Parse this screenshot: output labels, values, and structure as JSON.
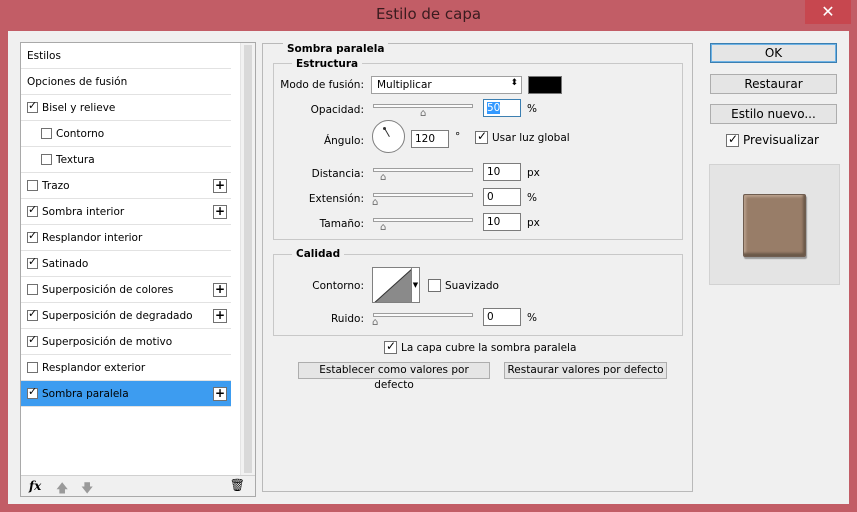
{
  "window": {
    "title": "Estilo de capa",
    "close_icon": "✕"
  },
  "styles_list": {
    "items": [
      {
        "label": "Estilos",
        "checkbox": false,
        "checked": false,
        "plus": false,
        "sub": false,
        "selected": false
      },
      {
        "label": "Opciones de fusión",
        "checkbox": false,
        "checked": false,
        "plus": false,
        "sub": false,
        "selected": false
      },
      {
        "label": "Bisel y relieve",
        "checkbox": true,
        "checked": true,
        "plus": false,
        "sub": false,
        "selected": false
      },
      {
        "label": "Contorno",
        "checkbox": true,
        "checked": false,
        "plus": false,
        "sub": true,
        "selected": false
      },
      {
        "label": "Textura",
        "checkbox": true,
        "checked": false,
        "plus": false,
        "sub": true,
        "selected": false
      },
      {
        "label": "Trazo",
        "checkbox": true,
        "checked": false,
        "plus": true,
        "sub": false,
        "selected": false
      },
      {
        "label": "Sombra interior",
        "checkbox": true,
        "checked": true,
        "plus": true,
        "sub": false,
        "selected": false
      },
      {
        "label": "Resplandor interior",
        "checkbox": true,
        "checked": true,
        "plus": false,
        "sub": false,
        "selected": false
      },
      {
        "label": "Satinado",
        "checkbox": true,
        "checked": true,
        "plus": false,
        "sub": false,
        "selected": false
      },
      {
        "label": "Superposición de colores",
        "checkbox": true,
        "checked": false,
        "plus": true,
        "sub": false,
        "selected": false
      },
      {
        "label": "Superposición de degradado",
        "checkbox": true,
        "checked": true,
        "plus": true,
        "sub": false,
        "selected": false
      },
      {
        "label": "Superposición de motivo",
        "checkbox": true,
        "checked": true,
        "plus": false,
        "sub": false,
        "selected": false
      },
      {
        "label": "Resplandor exterior",
        "checkbox": true,
        "checked": false,
        "plus": false,
        "sub": false,
        "selected": false
      },
      {
        "label": "Sombra paralela",
        "checkbox": true,
        "checked": true,
        "plus": true,
        "sub": false,
        "selected": true
      }
    ],
    "footer": {
      "fx": "fx",
      "up_icon": "🡅",
      "down_icon": "🡇",
      "trash_icon": "🗑"
    }
  },
  "panel": {
    "title": "Sombra paralela",
    "structure": {
      "title": "Estructura",
      "blend_mode_label": "Modo de fusión:",
      "blend_mode_value": "Multiplicar",
      "shadow_color": "#000000",
      "opacity_label": "Opacidad:",
      "opacity_value": "50",
      "opacity_unit": "%",
      "opacity_level": 0.5,
      "angle_label": "Ángulo:",
      "angle_value": "120",
      "angle_unit": "°",
      "global_light_label": "Usar luz global",
      "global_light_checked": true,
      "distance_label": "Distancia:",
      "distance_value": "10",
      "distance_unit": "px",
      "spread_label": "Extensión:",
      "spread_value": "0",
      "spread_unit": "%",
      "size_label": "Tamaño:",
      "size_value": "10",
      "size_unit": "px"
    },
    "quality": {
      "title": "Calidad",
      "contour_label": "Contorno:",
      "antialias_label": "Suavizado",
      "antialias_checked": false,
      "noise_label": "Ruido:",
      "noise_value": "0",
      "noise_unit": "%"
    },
    "knockout_label": "La capa cubre la sombra paralela",
    "knockout_checked": true,
    "make_default_label": "Establecer como valores por defecto",
    "reset_default_label": "Restaurar valores por defecto"
  },
  "right": {
    "ok_label": "OK",
    "reset_label": "Restaurar",
    "new_style_label": "Estilo nuevo...",
    "preview_label": "Previsualizar",
    "preview_checked": true,
    "preview_color": "#987d68"
  }
}
